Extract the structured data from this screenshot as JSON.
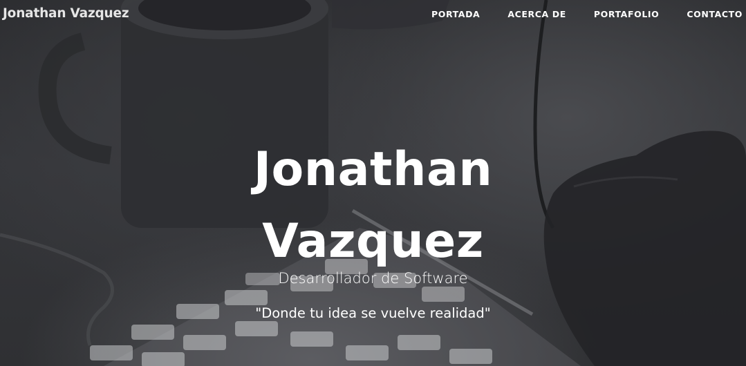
{
  "navbar": {
    "brand": "Jonathan Vazquez",
    "links": [
      "PORTADA",
      "ACERCA DE",
      "PORTAFOLIO",
      "CONTACTO"
    ]
  },
  "hero": {
    "title_line1": "Jonathan",
    "title_line2": "Vazquez",
    "subtitle": "Desarrollador de Software",
    "quote": "\"Donde tu idea se vuelve realidad\""
  }
}
